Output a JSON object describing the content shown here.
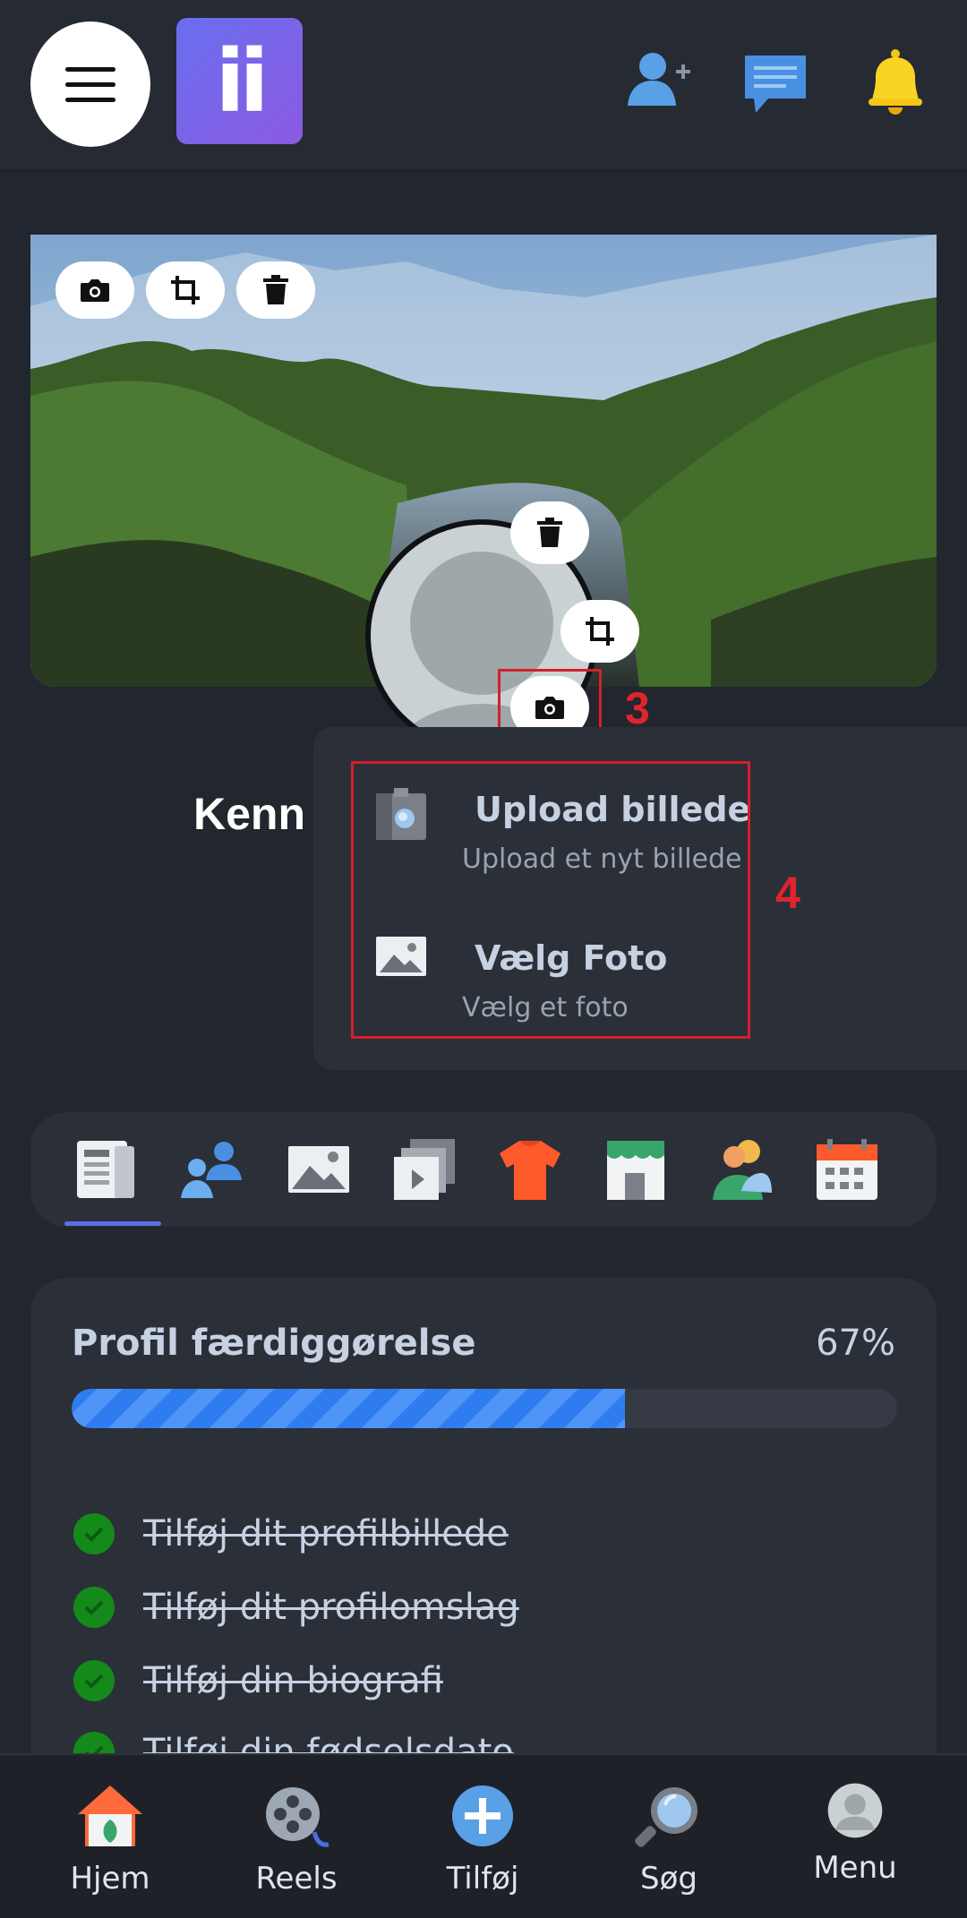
{
  "header": {
    "logo_text": "ii",
    "icons": [
      "hamburger-menu-icon",
      "add-friend-icon",
      "messages-icon",
      "notifications-bell-icon"
    ]
  },
  "cover": {
    "buttons": [
      "camera-icon",
      "crop-icon",
      "trash-icon"
    ]
  },
  "avatar": {
    "buttons": [
      "trash-icon",
      "crop-icon",
      "camera-icon"
    ]
  },
  "annotations": {
    "step3": "3",
    "step4": "4",
    "color": "#e0242c"
  },
  "profile": {
    "name_partial": "Kenn"
  },
  "photo_menu": {
    "items": [
      {
        "title": "Upload billede",
        "subtitle": "Upload et nyt billede",
        "icon": "upload-photo-icon"
      },
      {
        "title": "Vælg Foto",
        "subtitle": "Vælg et foto",
        "icon": "image-gallery-icon"
      }
    ]
  },
  "tabs": {
    "items": [
      "posts-icon",
      "friends-icon",
      "photos-icon",
      "videos-icon",
      "shirt-icon",
      "store-icon",
      "groups-icon",
      "calendar-icon"
    ],
    "active_index": 0,
    "accent": "#5b6ee6"
  },
  "completion": {
    "title": "Profil færdiggørelse",
    "percent_label": "67%",
    "percent": 67,
    "tasks": [
      "Tilføj dit profilbillede",
      "Tilføj dit profilomslag",
      "Tilføj din biografi",
      "Tilføj din fødselsdato"
    ]
  },
  "bottom_nav": {
    "items": [
      {
        "label": "Hjem",
        "icon": "home-icon"
      },
      {
        "label": "Reels",
        "icon": "film-reel-icon"
      },
      {
        "label": "Tilføj",
        "icon": "plus-icon"
      },
      {
        "label": "Søg",
        "icon": "search-icon"
      },
      {
        "label": "Menu",
        "icon": "user-menu-icon"
      }
    ]
  }
}
